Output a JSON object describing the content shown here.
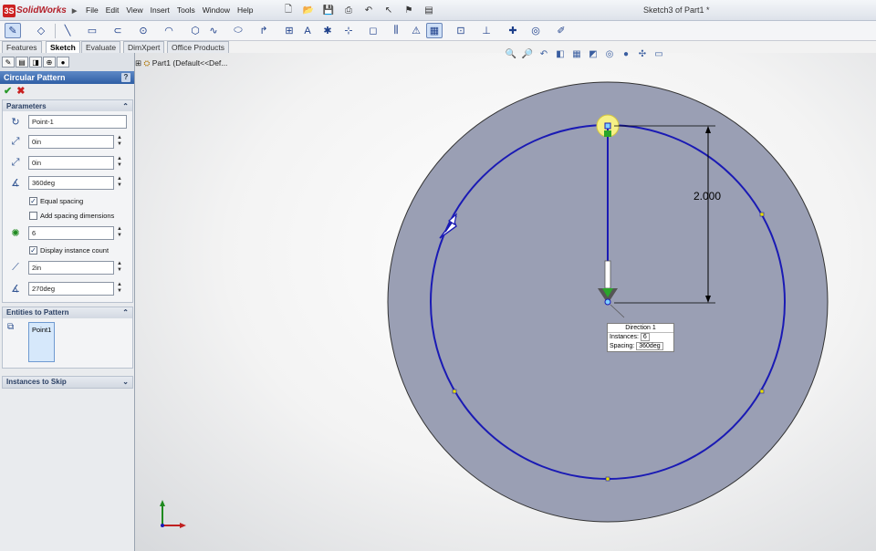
{
  "app": {
    "logo_text": "SolidWorks",
    "menus": [
      "File",
      "Edit",
      "View",
      "Insert",
      "Tools",
      "Window",
      "Help"
    ],
    "document_title": "Sketch3 of Part1 *"
  },
  "tabs": [
    "Features",
    "Sketch",
    "Evaluate",
    "DimXpert",
    "Office Products"
  ],
  "property_manager": {
    "title": "Circular Pattern",
    "help_label": "?",
    "ok_label": "✔",
    "cancel_label": "✖",
    "parameters_title": "Parameters",
    "center_point": "Point-1",
    "center_x": "0in",
    "center_y": "0in",
    "angle": "360deg",
    "equal_spacing_label": "Equal spacing",
    "equal_spacing_checked": true,
    "add_spacing_dims_label": "Add spacing dimensions",
    "add_spacing_dims_checked": false,
    "instances": "6",
    "display_instance_count_label": "Display instance count",
    "display_instance_count_checked": true,
    "radius": "2in",
    "arc_angle": "270deg",
    "entities_title": "Entities to Pattern",
    "entities": [
      "Point1"
    ],
    "instances_to_skip_title": "Instances to Skip"
  },
  "graphics": {
    "tree_label": "Part1  (Default<<Def...",
    "dimension_value": "2.000",
    "pattern_callout": {
      "title": "Direction 1",
      "instances_label": "Instances:",
      "instances_value": "6",
      "spacing_label": "Spacing:",
      "spacing_value": "360deg"
    },
    "colors": {
      "disk_fill": "#9a9fb4",
      "pattern_circle": "#1a1ab4",
      "highlight": "#f6f086"
    }
  }
}
